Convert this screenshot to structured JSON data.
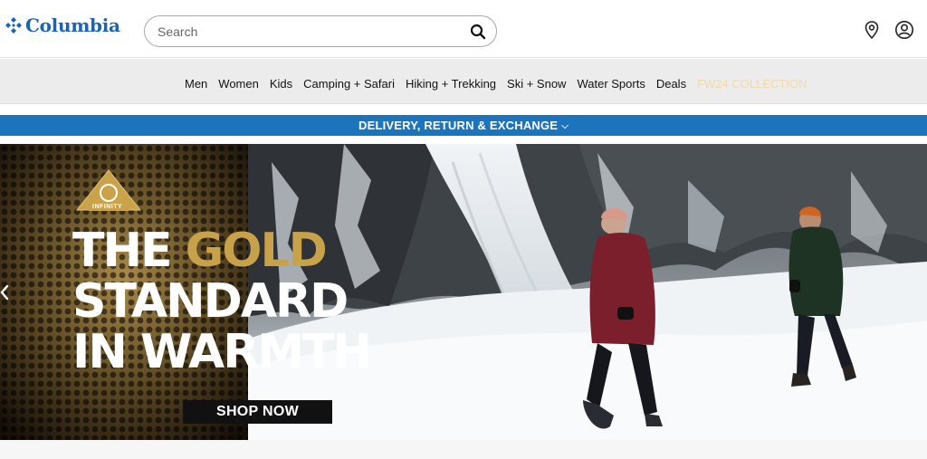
{
  "header": {
    "brand": "Columbia",
    "search": {
      "placeholder": "Search",
      "value": ""
    },
    "icons": [
      "store-locator-icon",
      "account-icon"
    ]
  },
  "nav": {
    "items": [
      {
        "label": "Men"
      },
      {
        "label": "Women"
      },
      {
        "label": "Kids"
      },
      {
        "label": "Camping + Safari"
      },
      {
        "label": "Hiking + Trekking"
      },
      {
        "label": "Ski + Snow"
      },
      {
        "label": "Water Sports"
      },
      {
        "label": "Deals"
      },
      {
        "label": "FW24 COLLECTION"
      }
    ]
  },
  "banner": {
    "text": "DELIVERY, RETURN & EXCHANGE"
  },
  "hero": {
    "badge": "INFINITY",
    "line1_a": "THE ",
    "line1_b": "GOLD",
    "line2": "STANDARD",
    "line3": "IN WARMTH",
    "cta": "SHOP NOW"
  },
  "colors": {
    "brand_blue": "#1a64b3",
    "banner_blue": "#1c75bc",
    "nav_bg": "#ececed",
    "gold": "#c8a24a",
    "promo_text": "#f3d9a8"
  }
}
